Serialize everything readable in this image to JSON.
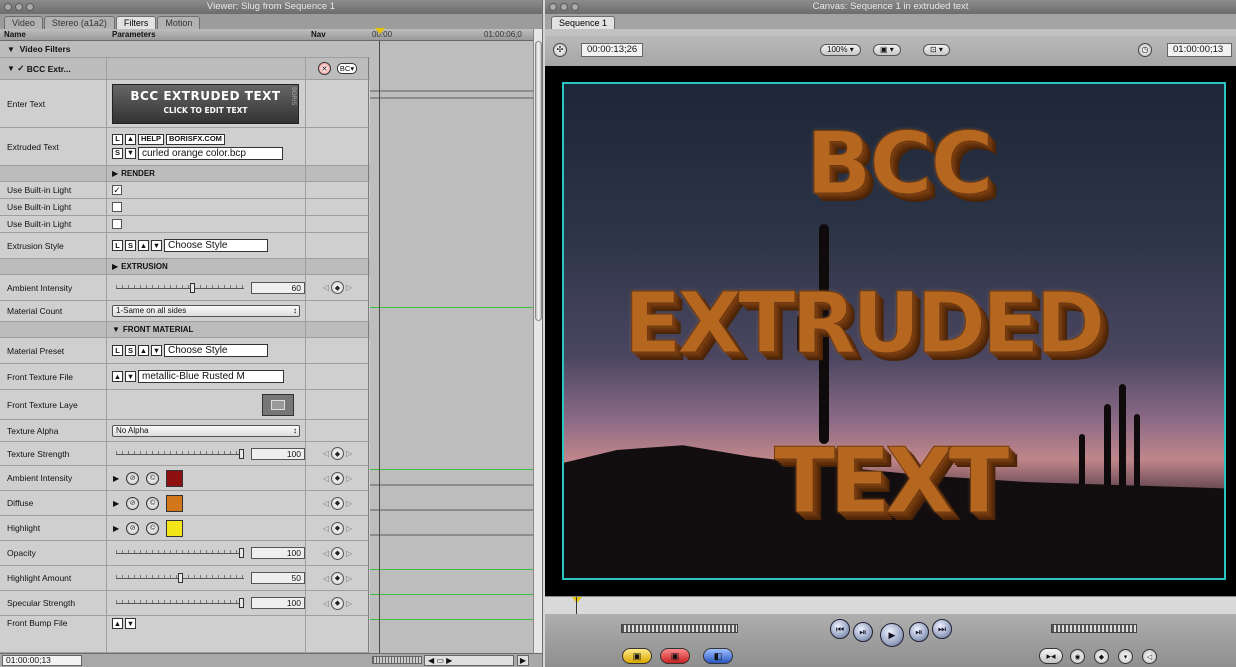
{
  "viewer": {
    "title": "Viewer: Slug from Sequence 1",
    "tabs": [
      "Video",
      "Stereo (a1a2)",
      "Filters",
      "Motion"
    ],
    "columns": {
      "name": "Name",
      "parameters": "Parameters",
      "nav": "Nav",
      "tc_start": "00:00",
      "tc_end": "01:00:06;0"
    },
    "video_filters": "Video Filters",
    "filter_name": "BCC Extr...",
    "banner_title": "BCC EXTRUDED TEXT",
    "banner_sub": "CLICK TO EDIT TEXT",
    "banner_side": "BORIS",
    "btn_help": "HELP",
    "btn_borisfx": "BORISFX.COM",
    "btn_l": "L",
    "btn_s": "S",
    "btn_up": "▲",
    "btn_down": "▼",
    "rows": {
      "enter_text": "Enter Text",
      "extruded_text": "Extruded Text",
      "extruded_text_file": "curled orange color.bcp",
      "render": "RENDER",
      "use_light_1": "Use Built-in Light",
      "use_light_2": "Use Built-in Light",
      "use_light_3": "Use Built-in Light",
      "extrusion_style": "Extrusion Style",
      "choose_style": "Choose Style",
      "extrusion": "EXTRUSION",
      "ambient_intensity": "Ambient Intensity",
      "ambient_value": "60",
      "material_count": "Material Count",
      "material_count_value": "1-Same on all sides",
      "front_material": "FRONT MATERIAL",
      "material_preset": "Material Preset",
      "material_preset_value": "Choose Style",
      "front_texture_file": "Front Texture File",
      "front_texture_value": "metallic-Blue Rusted M",
      "front_texture_layer": "Front Texture Laye",
      "texture_alpha": "Texture Alpha",
      "texture_alpha_value": "No Alpha",
      "texture_strength": "Texture Strength",
      "texture_strength_value": "100",
      "ambient_intensity_2": "Ambient Intensity",
      "diffuse": "Diffuse",
      "highlight": "Highlight",
      "opacity": "Opacity",
      "opacity_value": "100",
      "highlight_amount": "Highlight Amount",
      "highlight_amount_value": "50",
      "specular_strength": "Specular Strength",
      "specular_strength_value": "100",
      "front_bump_file": "Front Bump File"
    },
    "slider_levels": {
      "ambient": 0.6,
      "texture_strength": 1.0,
      "opacity": 1.0,
      "highlight_amount": 0.5,
      "specular": 1.0
    },
    "swatches": {
      "ambient": "#8f1010",
      "diffuse": "#d2761a",
      "highlight": "#f2e61a"
    },
    "timecode": "01:00:00;13"
  },
  "canvas": {
    "title": "Canvas: Sequence 1 in extruded text",
    "tab": "Sequence 1",
    "duration": "00:00:13;26",
    "zoom": "100%",
    "current_tc": "01:00:00;13",
    "text_lines": [
      "BCC",
      "EXTRUDED",
      "TEXT"
    ]
  }
}
